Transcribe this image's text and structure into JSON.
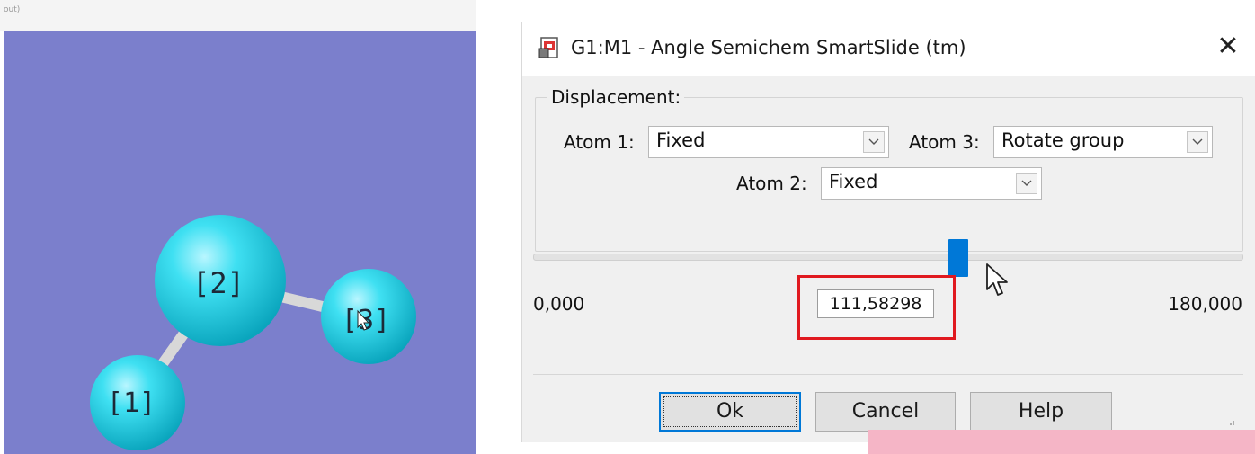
{
  "viewer": {
    "caption": "out)",
    "background_color": "#7b7fcc",
    "atom_color": "#1ed4e8",
    "atoms": [
      {
        "label": "[1]"
      },
      {
        "label": "[2]"
      },
      {
        "label": "[3]"
      }
    ]
  },
  "dialog": {
    "title": "G1:M1 - Angle Semichem SmartSlide (tm)",
    "close_glyph": "✕",
    "icon": "document-image-icon",
    "group_label": "Displacement:",
    "atom1": {
      "label": "Atom 1:",
      "value": "Fixed"
    },
    "atom2": {
      "label": "Atom 2:",
      "value": "Fixed"
    },
    "atom3": {
      "label": "Atom 3:",
      "value": "Rotate group"
    },
    "slider": {
      "min_label": "0,000",
      "max_label": "180,000",
      "value_text": "111,58298",
      "min": 0,
      "max": 180,
      "value": 111.58298
    },
    "buttons": {
      "ok": "Ok",
      "cancel": "Cancel",
      "help": "Help"
    },
    "accent_color": "#0078d7",
    "highlight_color": "#e0191f"
  }
}
